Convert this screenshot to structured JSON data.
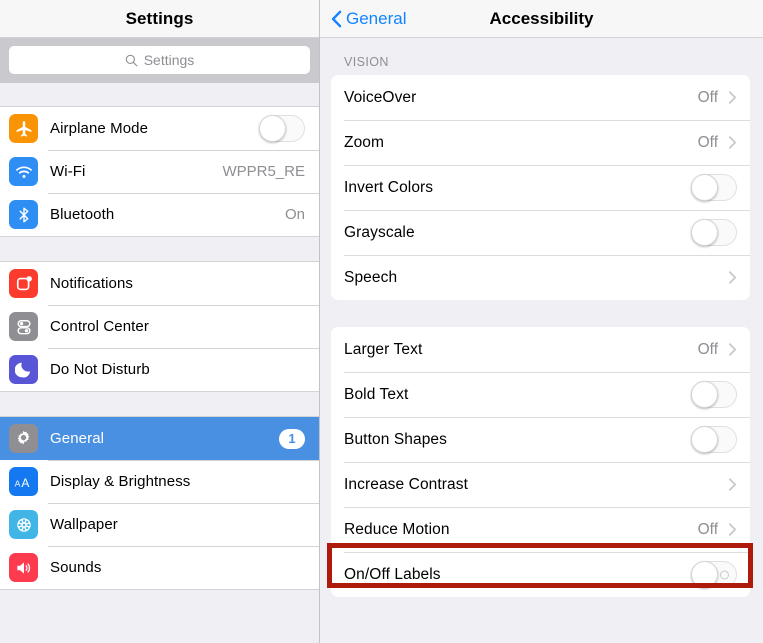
{
  "sidebar": {
    "title": "Settings",
    "search": {
      "placeholder": "Settings",
      "icon": "search-icon"
    },
    "groups": [
      {
        "items": [
          {
            "label": "Airplane Mode",
            "icon": "airplane-icon",
            "icon_color": "#f89406",
            "control": "toggle",
            "value": ""
          },
          {
            "label": "Wi-Fi",
            "icon": "wifi-icon",
            "icon_color": "#2f8ef4",
            "control": "value",
            "value": "WPPR5_RE"
          },
          {
            "label": "Bluetooth",
            "icon": "bluetooth-icon",
            "icon_color": "#2f8ef4",
            "control": "value",
            "value": "On"
          }
        ]
      },
      {
        "items": [
          {
            "label": "Notifications",
            "icon": "notifications-icon",
            "icon_color": "#fc3b2f",
            "control": "none",
            "value": ""
          },
          {
            "label": "Control Center",
            "icon": "control-center-icon",
            "icon_color": "#8e8e93",
            "control": "none",
            "value": ""
          },
          {
            "label": "Do Not Disturb",
            "icon": "moon-icon",
            "icon_color": "#5856d6",
            "control": "none",
            "value": ""
          }
        ]
      },
      {
        "items": [
          {
            "label": "General",
            "icon": "gear-icon",
            "icon_color": "#8e8e93",
            "control": "badge",
            "value": "1",
            "selected": true
          },
          {
            "label": "Display & Brightness",
            "icon": "text-size-icon",
            "icon_color": "#1479f0",
            "control": "none",
            "value": ""
          },
          {
            "label": "Wallpaper",
            "icon": "wallpaper-icon",
            "icon_color": "#41b6e6",
            "control": "none",
            "value": ""
          },
          {
            "label": "Sounds",
            "icon": "speaker-icon",
            "icon_color": "#fc3b4f",
            "control": "none",
            "value": ""
          }
        ]
      }
    ]
  },
  "detail": {
    "back_label": "General",
    "back_icon": "chevron-left-icon",
    "title": "Accessibility",
    "sections": [
      {
        "header": "VISION",
        "rows": [
          {
            "label": "VoiceOver",
            "value": "Off",
            "control": "disclosure"
          },
          {
            "label": "Zoom",
            "value": "Off",
            "control": "disclosure"
          },
          {
            "label": "Invert Colors",
            "value": "",
            "control": "toggle"
          },
          {
            "label": "Grayscale",
            "value": "",
            "control": "toggle"
          },
          {
            "label": "Speech",
            "value": "",
            "control": "disclosure"
          }
        ]
      },
      {
        "header": "",
        "rows": [
          {
            "label": "Larger Text",
            "value": "Off",
            "control": "disclosure"
          },
          {
            "label": "Bold Text",
            "value": "",
            "control": "toggle"
          },
          {
            "label": "Button Shapes",
            "value": "",
            "control": "toggle"
          },
          {
            "label": "Increase Contrast",
            "value": "",
            "control": "disclosure"
          },
          {
            "label": "Reduce Motion",
            "value": "Off",
            "control": "disclosure",
            "highlighted": true
          },
          {
            "label": "On/Off Labels",
            "value": "",
            "control": "toggle-labeled"
          }
        ]
      }
    ]
  },
  "annotation": {
    "color": "#ae1b0b",
    "target_label": "Reduce Motion"
  }
}
